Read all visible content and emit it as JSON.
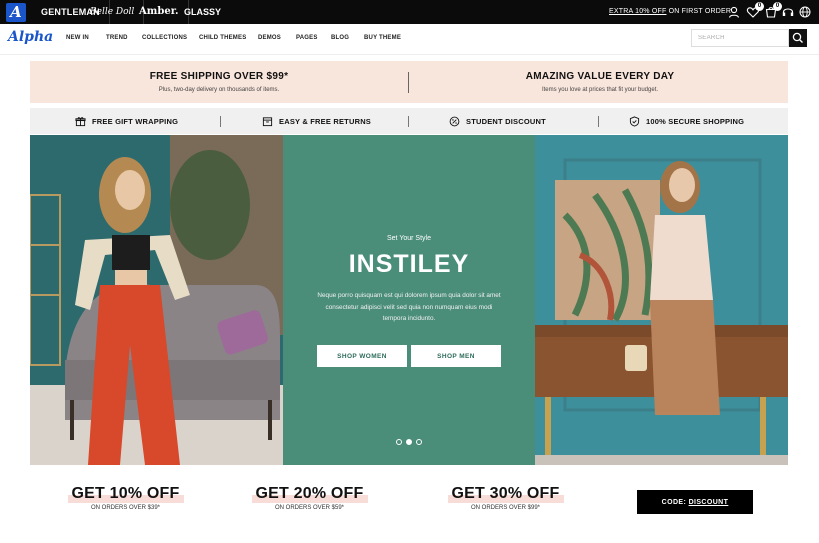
{
  "topbar": {
    "logo_letter": "A",
    "brands": [
      "GENTLEMAN",
      "Belle Doll",
      "Amber.",
      "GLASSY"
    ],
    "promo_prefix": "EXTRA 10% OFF",
    "promo_suffix": " ON FIRST ORDER",
    "wishlist_count": "0",
    "cart_count": "0"
  },
  "nav": {
    "logo": "Alpha",
    "items": [
      "NEW IN",
      "TREND",
      "COLLECTIONS",
      "CHILD THEMES",
      "DEMOS",
      "PAGES",
      "BLOG",
      "BUY THEME"
    ],
    "search_placeholder": "SEARCH"
  },
  "info": [
    {
      "title": "FREE SHIPPING OVER $99*",
      "subtitle": "Plus, two-day delivery on thousands of items."
    },
    {
      "title": "AMAZING VALUE EVERY DAY",
      "subtitle": "Items you love at prices that fit your budget."
    }
  ],
  "features": [
    {
      "label": "FREE GIFT WRAPPING",
      "icon": "gift-icon"
    },
    {
      "label": "EASY & FREE RETURNS",
      "icon": "box-icon"
    },
    {
      "label": "STUDENT DISCOUNT",
      "icon": "percent-icon"
    },
    {
      "label": "100% SECURE SHOPPING",
      "icon": "shield-icon"
    }
  ],
  "hero": {
    "kicker": "Set Your Style",
    "title": "INSTILEY",
    "text": "Neque porro quisquam est qui dolorem ipsum quia dolor sit amet consectetur adipisci velit sed quia non numquam eius modi tempora incidunto.",
    "buttons": [
      "SHOP WOMEN",
      "SHOP MEN"
    ],
    "colors": {
      "center": "#4a8d79",
      "left": "#2f6f70",
      "right": "#3e8f9a"
    }
  },
  "promos": [
    {
      "title": "GET 10% OFF",
      "subtitle": "ON ORDERS OVER $39*"
    },
    {
      "title": "GET 20% OFF",
      "subtitle": "ON ORDERS OVER $59*"
    },
    {
      "title": "GET 30% OFF",
      "subtitle": "ON ORDERS OVER $99*"
    }
  ],
  "code": {
    "prefix": "CODE: ",
    "value": "DISCOUNT"
  }
}
